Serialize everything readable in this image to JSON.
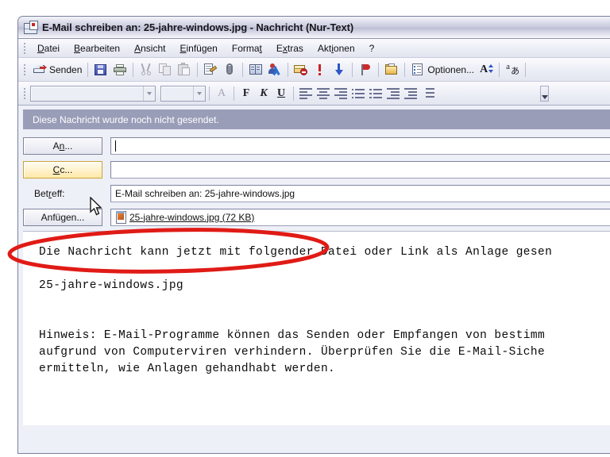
{
  "window": {
    "title": "E-Mail schreiben an: 25-jahre-windows.jpg - Nachricht (Nur-Text)",
    "icon": "mail-compose-icon"
  },
  "menu": {
    "items": [
      {
        "label": "Datei",
        "accel": "D"
      },
      {
        "label": "Bearbeiten",
        "accel": "B"
      },
      {
        "label": "Ansicht",
        "accel": "A"
      },
      {
        "label": "Einfügen",
        "accel": "E"
      },
      {
        "label": "Format",
        "accel": "t"
      },
      {
        "label": "Extras",
        "accel": "x"
      },
      {
        "label": "Aktionen",
        "accel": "i"
      },
      {
        "label": "?",
        "accel": ""
      }
    ]
  },
  "toolbar": {
    "send_label": "Senden",
    "options_label": "Optionen...",
    "icons": [
      "send-icon",
      "save-icon",
      "print-icon",
      "cut-icon",
      "copy-icon",
      "paste-icon",
      "format-painter-icon",
      "attach-file-icon",
      "address-book-icon",
      "check-names-icon",
      "block-sender-icon",
      "importance-high-icon",
      "importance-low-icon",
      "flag-icon",
      "move-to-folder-icon",
      "options-icon",
      "font-size-icon",
      "encoding-icon"
    ]
  },
  "format_toolbar": {
    "font_value": "",
    "size_value": "",
    "buttons": [
      "font-color-icon",
      "bold-B",
      "italic-K",
      "underline-U",
      "align-left-icon",
      "align-center-icon",
      "align-right-icon",
      "bullet-list-icon",
      "numbered-list-icon",
      "decrease-indent-icon",
      "increase-indent-icon",
      "line-spacing-icon"
    ],
    "bold_label": "F",
    "italic_label": "K",
    "underline_label": "U",
    "font_color_label": "A"
  },
  "info_bar": {
    "text": "Diese Nachricht wurde noch nicht gesendet."
  },
  "headers": {
    "to_button": "An...",
    "to_value": "",
    "cc_button": "Cc...",
    "cc_value": "",
    "subject_label": "Betreff:",
    "subject_value": "E-Mail schreiben an: 25-jahre-windows.jpg",
    "attach_button": "Anfügen...",
    "attachment_name": "25-jahre-windows.jpg (72 KB)",
    "attachment_icon": "image-file-icon"
  },
  "body": {
    "lines": [
      "Die Nachricht kann jetzt mit folgender Datei oder Link als Anlage gesen",
      "",
      "25-jahre-windows.jpg",
      "",
      "",
      "Hinweis: E-Mail-Programme können das Senden oder Empfangen von bestimm",
      "aufgrund von Computerviren verhindern. Überprüfen Sie die E-Mail-Siche",
      "ermitteln, wie Anlagen gehandhabt werden."
    ]
  },
  "annotation": {
    "shape": "red-ellipse-highlight",
    "color": "#e01b16"
  },
  "cursor": {
    "type": "arrow-pointer"
  }
}
